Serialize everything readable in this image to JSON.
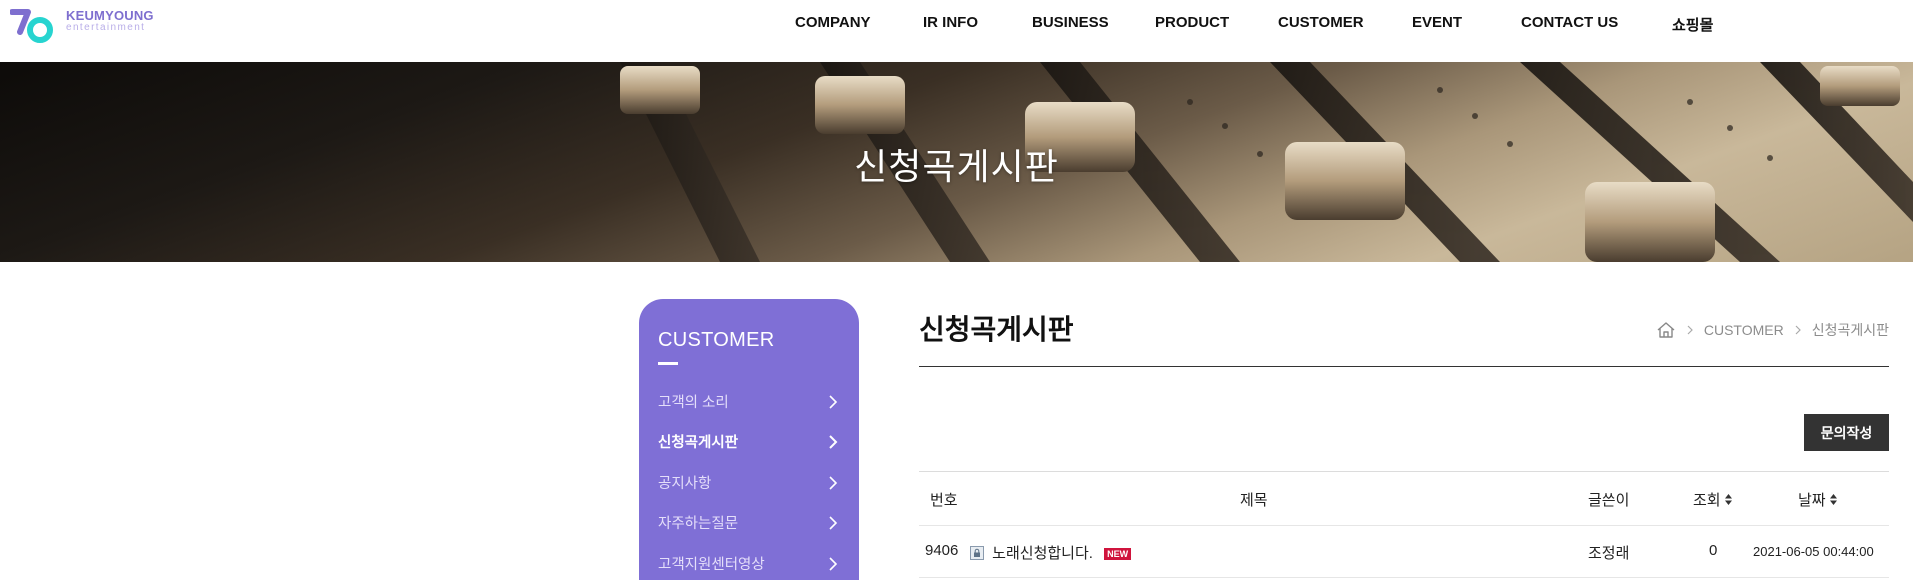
{
  "header": {
    "logo_name": "KEUMYOUNG",
    "logo_sub": "entertainment",
    "nav": [
      "COMPANY",
      "IR INFO",
      "BUSINESS",
      "PRODUCT",
      "CUSTOMER",
      "EVENT",
      "CONTACT US",
      "쇼핑몰"
    ]
  },
  "banner": {
    "title": "신청곡게시판"
  },
  "sidebar": {
    "title": "CUSTOMER",
    "items": [
      {
        "label": "고객의 소리"
      },
      {
        "label": "신청곡게시판"
      },
      {
        "label": "공지사항"
      },
      {
        "label": "자주하는질문"
      },
      {
        "label": "고객지원센터영상"
      }
    ],
    "active_index": 1
  },
  "content": {
    "page_title": "신청곡게시판",
    "breadcrumb": [
      "CUSTOMER",
      "신청곡게시판"
    ],
    "write_button": "문의작성",
    "table": {
      "headers": {
        "no": "번호",
        "subject": "제목",
        "author": "글쓴이",
        "views": "조회",
        "date": "날짜"
      },
      "rows": [
        {
          "no": "9406",
          "subject": "노래신청합니다.",
          "badge": "NEW",
          "author": "조정래",
          "views": "0",
          "date": "2021-06-05 00:44:00"
        }
      ]
    }
  },
  "colors": {
    "accent": "#7f6fd6",
    "button": "#333333",
    "new_badge": "#d0143d",
    "logo": "#7e6fcf",
    "logo_teal": "#27d4d0"
  },
  "icons": [
    "home-icon",
    "lock-icon",
    "chevron-right-icon",
    "sort-icon"
  ]
}
